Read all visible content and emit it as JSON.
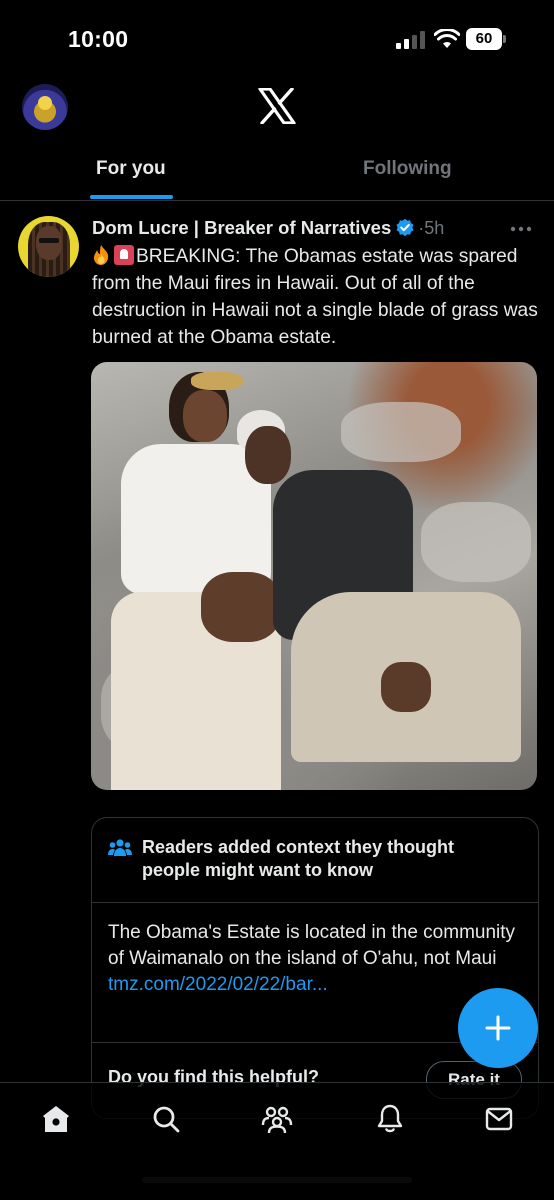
{
  "status_bar": {
    "time": "10:00",
    "battery": "60"
  },
  "header": {
    "logo": "x-logo"
  },
  "tabs": [
    {
      "label": "For you",
      "active": true
    },
    {
      "label": "Following",
      "active": false
    }
  ],
  "tweet": {
    "author": "Dom Lucre | Breaker of Narratives",
    "verified": true,
    "time_ago": "·5h",
    "text": "BREAKING: The Obamas estate was spared from the Maui fires in Hawaii. Out of all of the destruction in Hawaii not a single blade of grass was burned at the Obama estate.",
    "emojis": [
      "fire-emoji",
      "siren-emoji"
    ]
  },
  "community_note": {
    "title": "Readers added context they thought people might want to know",
    "body": "The Obama's Estate is located in the community of Waimanalo on the island of O'ahu, not Maui",
    "link": "tmz.com/2022/02/22/bar...",
    "question": "Do you find this helpful?",
    "rate_label": "Rate it"
  },
  "bottom_nav": [
    "home-icon",
    "search-icon",
    "communities-icon",
    "notifications-icon",
    "messages-icon"
  ],
  "colors": {
    "accent": "#1d9bf0",
    "background": "#000000",
    "text": "#e7e9ea",
    "muted": "#71767b",
    "border": "#2f3336"
  }
}
